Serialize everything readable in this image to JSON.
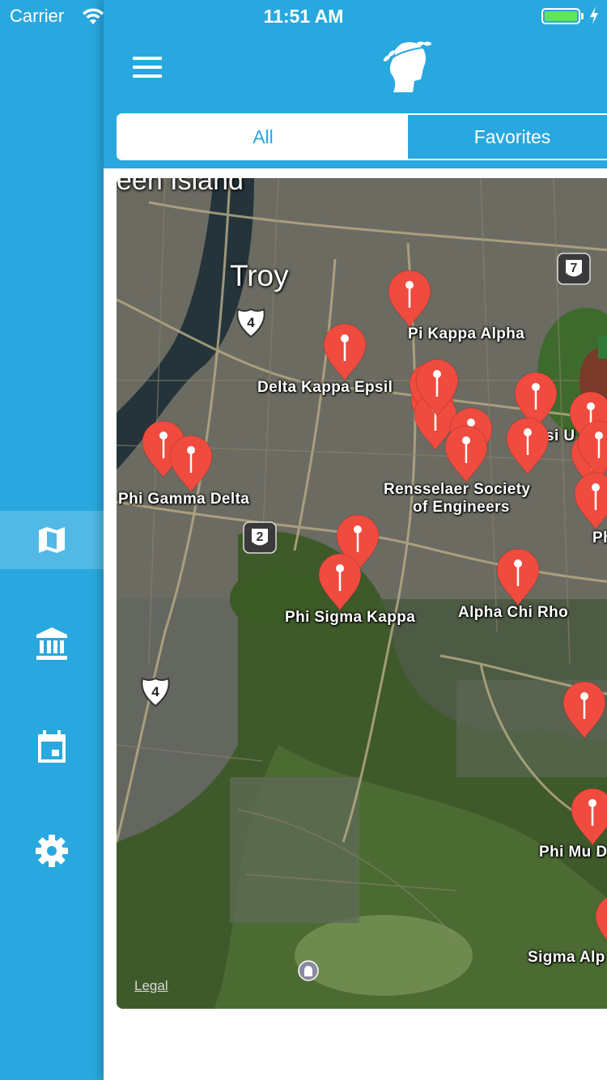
{
  "status": {
    "carrier": "Carrier",
    "time": "11:51 AM",
    "battery_level": 1.0
  },
  "colors": {
    "primary": "#29a8df",
    "active_rail": "#52b9e6",
    "pin": "#ef4b3f",
    "battery": "#5fe36b"
  },
  "sidebar": {
    "items": [
      {
        "icon": "map-icon",
        "active": true
      },
      {
        "icon": "bank-icon",
        "active": false
      },
      {
        "icon": "calendar-icon",
        "active": false
      },
      {
        "icon": "gear-icon",
        "active": false
      }
    ]
  },
  "header": {
    "menu_icon": "hamburger-menu-icon",
    "logo_icon": "laurel-head-logo-icon"
  },
  "segments": {
    "all": "All",
    "favorites": "Favorites",
    "selected": "All"
  },
  "map": {
    "city": "Troy",
    "island_text": "een Island",
    "labels": [
      "Pi Kappa Alpha",
      "Delta Kappa Epsil",
      "Phi Gamma Delta",
      "Rensselaer Society",
      "of Engineers",
      "Phi Sigma Kappa",
      "Alpha Chi Rho",
      "si U",
      "Ph",
      "Phi Mu D",
      "Sigma Alp"
    ],
    "route_shields": [
      "7",
      "4",
      "2",
      "4"
    ],
    "legal": "Legal"
  }
}
